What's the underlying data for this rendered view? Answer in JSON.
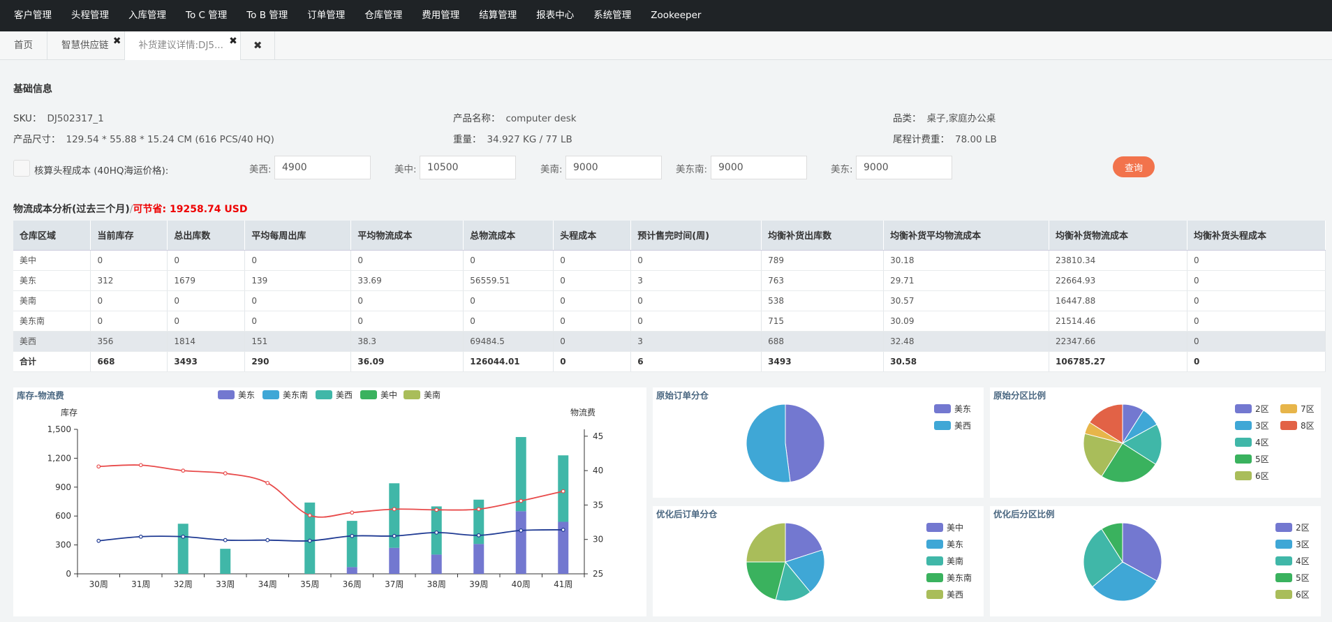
{
  "nav": [
    "客户管理",
    "头程管理",
    "入库管理",
    "To C 管理",
    "To B 管理",
    "订单管理",
    "仓库管理",
    "费用管理",
    "结算管理",
    "报表中心",
    "系统管理",
    "Zookeeper"
  ],
  "tabs": {
    "home": "首页",
    "supply": "智慧供应链",
    "detail": "补货建议详情:DJ5...",
    "close_all": "✖"
  },
  "basic": {
    "title": "基础信息",
    "sku_label": "SKU：",
    "sku": "DJ502317_1",
    "name_label": "产品名称：",
    "name": "computer desk",
    "category_label": "品类：",
    "category": "桌子,家庭办公桌",
    "size_label": "产品尺寸：",
    "size": "129.54 * 55.88 * 15.24 CM (616 PCS/40 HQ)",
    "weight_label": "重量：",
    "weight": "34.927 KG / 77 LB",
    "tail_weight_label": "尾程计费重：",
    "tail_weight": "78.00 LB"
  },
  "freight_form": {
    "checkbox_label": "核算头程成本 (40HQ海运价格):",
    "fields": [
      {
        "label": "美西:",
        "value": "4900"
      },
      {
        "label": "美中:",
        "value": "10500"
      },
      {
        "label": "美南:",
        "value": "9000"
      },
      {
        "label": "美东南:",
        "value": "9000"
      },
      {
        "label": "美东:",
        "value": "9000"
      }
    ],
    "query_button": "查询"
  },
  "cost_analysis": {
    "title": "物流成本分析(过去三个月)",
    "separator": "/",
    "saving": "可节省: 19258.74 USD",
    "headers": [
      "仓库区域",
      "当前库存",
      "总出库数",
      "平均每周出库",
      "平均物流成本",
      "总物流成本",
      "头程成本",
      "预计售完时间(周)",
      "均衡补货出库数",
      "均衡补货平均物流成本",
      "均衡补货物流成本",
      "均衡补货头程成本"
    ],
    "rows": [
      [
        "美中",
        "0",
        "0",
        "0",
        "0",
        "0",
        "0",
        "0",
        "789",
        "30.18",
        "23810.34",
        "0"
      ],
      [
        "美东",
        "312",
        "1679",
        "139",
        "33.69",
        "56559.51",
        "0",
        "3",
        "763",
        "29.71",
        "22664.93",
        "0"
      ],
      [
        "美南",
        "0",
        "0",
        "0",
        "0",
        "0",
        "0",
        "0",
        "538",
        "30.57",
        "16447.88",
        "0"
      ],
      [
        "美东南",
        "0",
        "0",
        "0",
        "0",
        "0",
        "0",
        "0",
        "715",
        "30.09",
        "21514.46",
        "0"
      ],
      [
        "美西",
        "356",
        "1814",
        "151",
        "38.3",
        "69484.5",
        "0",
        "3",
        "688",
        "32.48",
        "22347.66",
        "0"
      ],
      [
        "合计",
        "668",
        "3493",
        "290",
        "36.09",
        "126044.01",
        "0",
        "6",
        "3493",
        "30.58",
        "106785.27",
        "0"
      ]
    ]
  },
  "colors": {
    "c_purple": "#7378d0",
    "c_blue": "#3fa7d6",
    "c_teal": "#40b7a8",
    "c_green": "#3ab25e",
    "c_olive": "#a9bd5a",
    "c_yellow": "#e7b54a",
    "c_red": "#e26246",
    "line_red": "#e84a4a",
    "line_navy": "#1f3a93"
  },
  "chart_data": [
    {
      "type": "bar",
      "title": "库存-物流费",
      "ylabel": "库存",
      "y2label": "物流费",
      "ylim": [
        0,
        1500
      ],
      "yticks": [
        "1,500",
        "1,200",
        "900",
        "600",
        "300",
        "0"
      ],
      "y2lim": [
        25,
        46
      ],
      "y2ticks": [
        "45",
        "40",
        "35",
        "30",
        "25"
      ],
      "categories": [
        "30周",
        "31周",
        "32周",
        "33周",
        "34周",
        "35周",
        "36周",
        "37周",
        "38周",
        "39周",
        "40周",
        "41周"
      ],
      "legend": [
        "美东",
        "美东南",
        "美西",
        "美中",
        "美南"
      ],
      "series": [
        {
          "name": "美东",
          "kind": "bar",
          "color": "c_purple",
          "values": [
            0,
            0,
            0,
            0,
            0,
            0,
            70,
            270,
            200,
            310,
            650,
            540
          ]
        },
        {
          "name": "美西",
          "kind": "bar",
          "color": "c_teal",
          "values": [
            0,
            0,
            520,
            260,
            0,
            740,
            480,
            670,
            500,
            460,
            770,
            690
          ]
        },
        {
          "kind": "line",
          "color": "line_red",
          "axis": "right",
          "values": [
            40.6,
            40.8,
            40.0,
            39.6,
            38.2,
            33.5,
            33.9,
            34.4,
            34.3,
            34.4,
            35.6,
            37.0
          ]
        },
        {
          "kind": "line",
          "color": "line_navy",
          "axis": "right",
          "values": [
            29.8,
            30.4,
            30.4,
            29.9,
            29.9,
            29.8,
            30.5,
            30.5,
            31.0,
            30.6,
            31.3,
            31.4
          ]
        }
      ]
    },
    {
      "type": "pie",
      "title": "原始订单分仓",
      "slices": [
        {
          "name": "美东",
          "value": 48,
          "color": "c_purple"
        },
        {
          "name": "美西",
          "value": 52,
          "color": "c_blue"
        }
      ]
    },
    {
      "type": "pie",
      "title": "原始分区比例",
      "legend": [
        "2区",
        "3区",
        "4区",
        "5区",
        "6区",
        "7区",
        "8区"
      ],
      "slices": [
        {
          "name": "2区",
          "value": 9,
          "color": "c_purple"
        },
        {
          "name": "3区",
          "value": 8,
          "color": "c_blue"
        },
        {
          "name": "4区",
          "value": 17,
          "color": "c_teal"
        },
        {
          "name": "5区",
          "value": 25,
          "color": "c_green"
        },
        {
          "name": "6区",
          "value": 20,
          "color": "c_olive"
        },
        {
          "name": "7区",
          "value": 5,
          "color": "c_yellow"
        },
        {
          "name": "8区",
          "value": 16,
          "color": "c_red"
        }
      ]
    },
    {
      "type": "pie",
      "title": "优化后订单分仓",
      "slices": [
        {
          "name": "美中",
          "value": 20,
          "color": "c_purple"
        },
        {
          "name": "美东",
          "value": 19,
          "color": "c_blue"
        },
        {
          "name": "美南",
          "value": 15,
          "color": "c_teal"
        },
        {
          "name": "美东南",
          "value": 21,
          "color": "c_green"
        },
        {
          "name": "美西",
          "value": 25,
          "color": "c_olive"
        }
      ]
    },
    {
      "type": "pie",
      "title": "优化后分区比例",
      "slices": [
        {
          "name": "2区",
          "value": 33,
          "color": "c_purple"
        },
        {
          "name": "3区",
          "value": 31,
          "color": "c_blue"
        },
        {
          "name": "4区",
          "value": 27,
          "color": "c_teal"
        },
        {
          "name": "5区",
          "value": 9,
          "color": "c_green"
        },
        {
          "name": "6区",
          "value": 0,
          "color": "c_olive"
        }
      ]
    }
  ]
}
